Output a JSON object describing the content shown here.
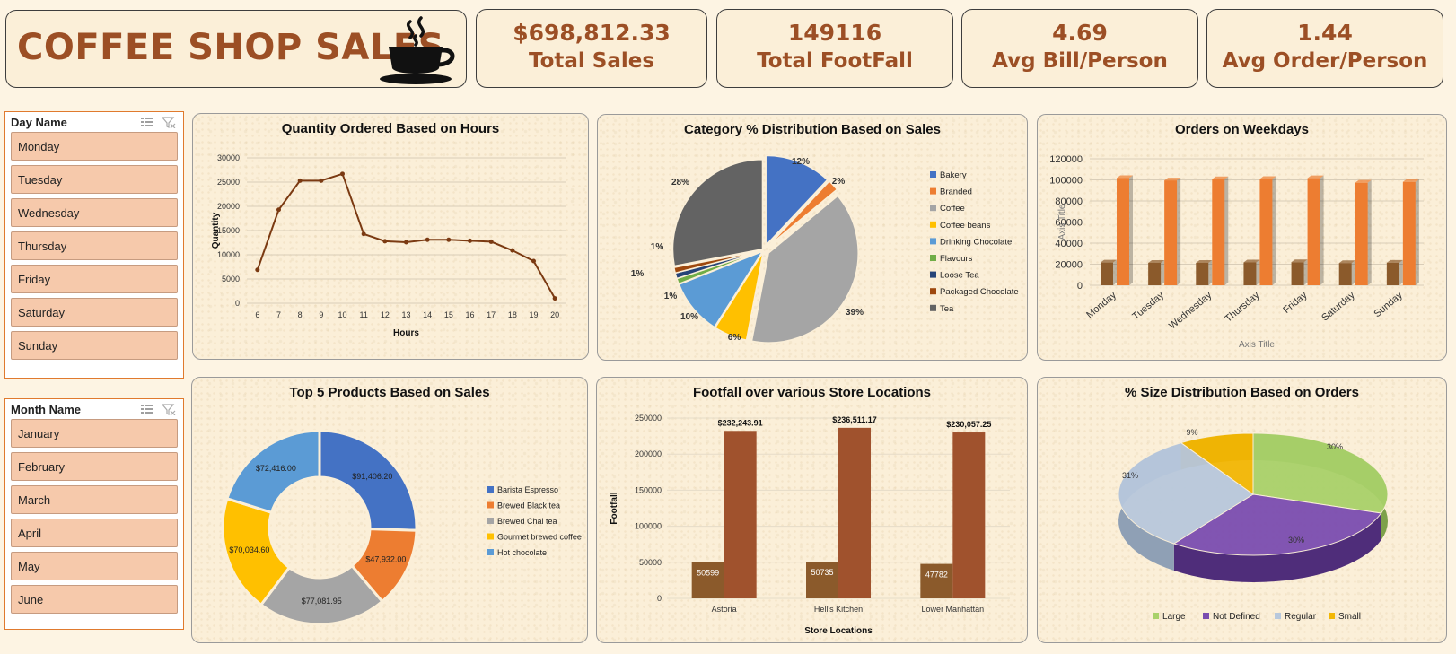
{
  "header": {
    "title": "COFFEE SHOP SALES",
    "icon": "coffee-cup-icon"
  },
  "kpis": [
    {
      "value": "$698,812.33",
      "label": "Total Sales"
    },
    {
      "value": "149116",
      "label": "Total FootFall"
    },
    {
      "value": "4.69",
      "label": "Avg Bill/Person"
    },
    {
      "value": "1.44",
      "label": "Avg Order/Person"
    }
  ],
  "slicers": {
    "day": {
      "title": "Day Name",
      "items": [
        "Monday",
        "Tuesday",
        "Wednesday",
        "Thursday",
        "Friday",
        "Saturday",
        "Sunday"
      ]
    },
    "month": {
      "title": "Month Name",
      "items": [
        "January",
        "February",
        "March",
        "April",
        "May",
        "June"
      ]
    }
  },
  "colors": {
    "accent": "#9c4f25",
    "slicer_item": "#f6c9ab",
    "slicer_border": "#e07a2e"
  },
  "chart_data": [
    {
      "id": "hours",
      "type": "line",
      "title": "Quantity Ordered Based on Hours",
      "xlabel": "Hours",
      "ylabel": "Quantity",
      "x": [
        6,
        7,
        8,
        9,
        10,
        11,
        12,
        13,
        14,
        15,
        16,
        17,
        18,
        19,
        20
      ],
      "values": [
        6900,
        19300,
        25300,
        25300,
        26700,
        14300,
        12800,
        12600,
        13100,
        13100,
        12900,
        12700,
        10900,
        8700,
        1000
      ],
      "yticks": [
        0,
        5000,
        10000,
        15000,
        20000,
        25000,
        30000
      ],
      "ylim": [
        0,
        30000
      ],
      "color": "#7b3a12"
    },
    {
      "id": "category",
      "type": "pie",
      "title": "Category % Distribution Based on Sales",
      "categories": [
        "Bakery",
        "Branded",
        "Coffee",
        "Coffee beans",
        "Drinking Chocolate",
        "Flavours",
        "Loose Tea",
        "Packaged Chocolate",
        "Tea"
      ],
      "values": [
        12,
        2,
        39,
        6,
        10,
        1,
        1,
        1,
        28
      ],
      "labels": [
        "12%",
        "2%",
        "39%",
        "6%",
        "10%",
        "1%",
        "1%",
        "1%",
        "28%"
      ],
      "colors": [
        "#4472c4",
        "#ed7d31",
        "#a5a5a5",
        "#ffc000",
        "#5b9bd5",
        "#70ad47",
        "#264478",
        "#9e480e",
        "#636363"
      ],
      "legend": "right"
    },
    {
      "id": "weekdays",
      "type": "bar",
      "title": "Orders on Weekdays",
      "xlabel": "Axis Title",
      "ylabel": "Axis Title",
      "categories": [
        "Monday",
        "Tuesday",
        "Wednesday",
        "Thursday",
        "Friday",
        "Saturday",
        "Sunday"
      ],
      "series": [
        {
          "values": [
            21600,
            21300,
            21300,
            21700,
            21900,
            21100,
            21400
          ],
          "color": "#8b5a2b"
        },
        {
          "values": [
            101700,
            99500,
            100600,
            100800,
            101600,
            97300,
            98100
          ],
          "color": "#ed7d31"
        }
      ],
      "yticks": [
        0,
        20000,
        40000,
        60000,
        80000,
        100000,
        120000
      ],
      "ylim": [
        0,
        120000
      ]
    },
    {
      "id": "top5",
      "type": "pie",
      "subtype": "doughnut",
      "title": "Top 5 Products Based on Sales",
      "categories": [
        "Barista Espresso",
        "Brewed Black tea",
        "Brewed Chai tea",
        "Gourmet brewed coffee",
        "Hot chocolate"
      ],
      "values": [
        91406.2,
        47932.0,
        77081.95,
        70034.6,
        72416.0
      ],
      "labels": [
        "$91,406.20",
        "$47,932.00",
        "$77,081.95",
        "$70,034.60",
        "$72,416.00"
      ],
      "colors": [
        "#4472c4",
        "#ed7d31",
        "#a5a5a5",
        "#ffc000",
        "#5b9bd5"
      ],
      "legend": "right"
    },
    {
      "id": "locations",
      "type": "bar",
      "title": "Footfall over various Store Locations",
      "xlabel": "Store Locations",
      "ylabel": "Footfall",
      "categories": [
        "Astoria",
        "Hell's Kitchen",
        "Lower Manhattan"
      ],
      "series": [
        {
          "values": [
            50599,
            50735,
            47782
          ],
          "labels": [
            "50599",
            "50735",
            "47782"
          ],
          "color": "#8b5a2b"
        },
        {
          "values": [
            232243.91,
            236511.17,
            230057.25
          ],
          "labels": [
            "$232,243.91",
            "$236,511.17",
            "$230,057.25"
          ],
          "color": "#a0522d"
        }
      ],
      "yticks": [
        0,
        50000,
        100000,
        150000,
        200000,
        250000
      ],
      "ylim": [
        0,
        250000
      ]
    },
    {
      "id": "size",
      "type": "pie",
      "subtype": "3d",
      "title": "% Size Distribution Based on Orders",
      "categories": [
        "Large",
        "Not Defined",
        "Regular",
        "Small"
      ],
      "values": [
        30,
        30,
        31,
        9
      ],
      "labels": [
        "30%",
        "30%",
        "31%",
        "9%"
      ],
      "colors": [
        "#a9d16a",
        "#7b4db0",
        "#b8c8dc",
        "#f2b705"
      ],
      "legend": "bottom"
    }
  ]
}
